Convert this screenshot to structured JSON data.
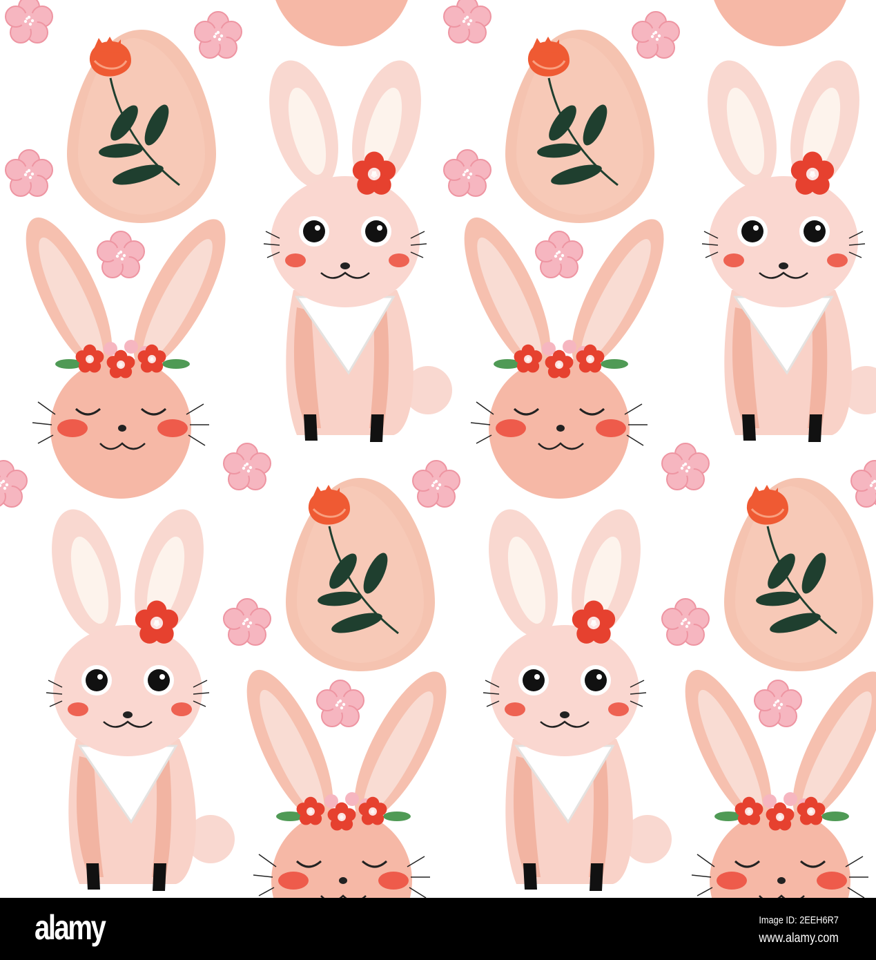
{
  "footer": {
    "logo": "alamy",
    "image_id": "Image ID: 2EEH6R7",
    "url": "www.alamy.com"
  },
  "colors": {
    "egg": "#f5c3b0",
    "bunny_light": "#fad7d0",
    "bunny_face": "#f6b8a6",
    "cheek": "#ee6252",
    "flower_red": "#e6412f",
    "leaf": "#1f3f2f",
    "blossom": "#f6b6c0"
  }
}
